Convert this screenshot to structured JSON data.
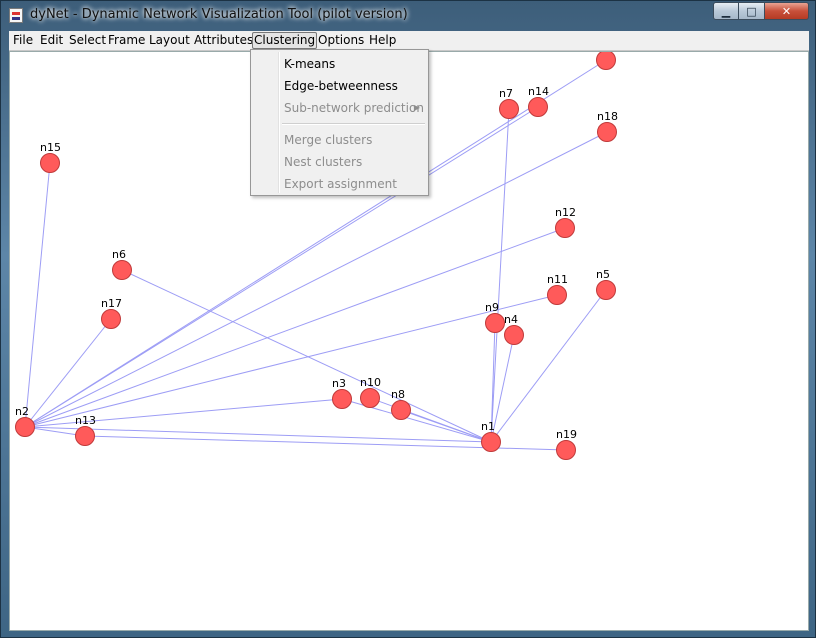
{
  "window": {
    "title": "dyNet - Dynamic Network Visualization Tool (pilot version)"
  },
  "menubar": [
    {
      "label": "File"
    },
    {
      "label": "Edit"
    },
    {
      "label": "Select"
    },
    {
      "label": "Frame"
    },
    {
      "label": "Layout"
    },
    {
      "label": "Attributes"
    },
    {
      "label": "Clustering"
    },
    {
      "label": "Options"
    },
    {
      "label": "Help"
    }
  ],
  "clustering_menu": {
    "items": [
      {
        "label": "K-means",
        "enabled": true
      },
      {
        "label": "Edge-betweenness",
        "enabled": true
      },
      {
        "label": "Sub-network prediction",
        "enabled": false,
        "submenu": true
      },
      {
        "label": "Merge clusters",
        "enabled": false
      },
      {
        "label": "Nest clusters",
        "enabled": false
      },
      {
        "label": "Export assignment",
        "enabled": false
      }
    ]
  },
  "graph": {
    "nodes": [
      {
        "id": "n1",
        "label": "n1"
      },
      {
        "id": "n2",
        "label": "n2"
      },
      {
        "id": "n3",
        "label": "n3"
      },
      {
        "id": "n4",
        "label": "n4"
      },
      {
        "id": "n5",
        "label": "n5"
      },
      {
        "id": "n6",
        "label": "n6"
      },
      {
        "id": "n7",
        "label": "n7"
      },
      {
        "id": "n8",
        "label": "n8"
      },
      {
        "id": "n9",
        "label": "n9"
      },
      {
        "id": "n10",
        "label": "n10"
      },
      {
        "id": "n11",
        "label": "n11"
      },
      {
        "id": "n12",
        "label": "n12"
      },
      {
        "id": "n13",
        "label": "n13"
      },
      {
        "id": "n14",
        "label": "n14"
      },
      {
        "id": "n15",
        "label": "n15"
      },
      {
        "id": "n16",
        "label": ""
      },
      {
        "id": "n17",
        "label": "n17"
      },
      {
        "id": "n18",
        "label": "n18"
      },
      {
        "id": "n19",
        "label": "n19"
      }
    ],
    "edges": [
      [
        "n2",
        "n15"
      ],
      [
        "n2",
        "n17"
      ],
      [
        "n2",
        "n13"
      ],
      [
        "n2",
        "n3"
      ],
      [
        "n2",
        "n11"
      ],
      [
        "n2",
        "n12"
      ],
      [
        "n2",
        "n18"
      ],
      [
        "n2",
        "n14"
      ],
      [
        "n2",
        "n16"
      ],
      [
        "n2",
        "n1"
      ],
      [
        "n13",
        "n19"
      ],
      [
        "n6",
        "n1"
      ],
      [
        "n3",
        "n1"
      ],
      [
        "n10",
        "n1"
      ],
      [
        "n8",
        "n1"
      ],
      [
        "n7",
        "n1"
      ],
      [
        "n9",
        "n1"
      ],
      [
        "n4",
        "n1"
      ],
      [
        "n5",
        "n1"
      ]
    ],
    "colors": {
      "node_fill": "#ff5a5a",
      "node_stroke": "#c03a3a",
      "edge": "#9d9df5"
    }
  }
}
